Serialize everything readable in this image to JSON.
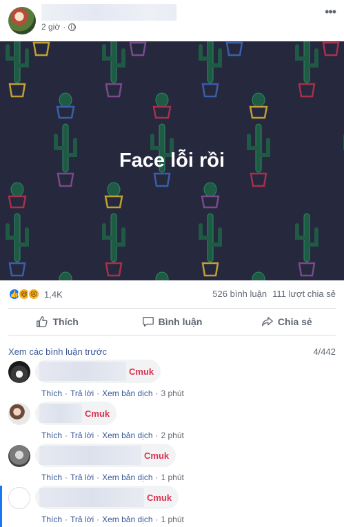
{
  "post": {
    "time": "2 giờ",
    "image_text": "Face lỗi rồi"
  },
  "stats": {
    "reaction_count": "1,4K",
    "comments": "526 bình luận",
    "shares": "111 lượt chia sẻ"
  },
  "actions": {
    "like": "Thích",
    "comment": "Bình luận",
    "share": "Chia sẻ"
  },
  "comments_section": {
    "view_previous": "Xem các bình luận trước",
    "count": "4/442",
    "items": [
      {
        "text": "Cmuk",
        "like": "Thích",
        "reply": "Trả lời",
        "translate": "Xem bản dịch",
        "time": "3 phút"
      },
      {
        "text": "Cmuk",
        "like": "Thích",
        "reply": "Trả lời",
        "translate": "Xem bản dịch",
        "time": "2 phút"
      },
      {
        "text": "Cmuk",
        "like": "Thích",
        "reply": "Trả lời",
        "translate": "Xem bản dịch",
        "time": "1 phút"
      },
      {
        "text": "Cmuk",
        "like": "Thích",
        "reply": "Trả lời",
        "translate": "Xem bản dịch",
        "time": "1 phút"
      }
    ]
  },
  "colors": {
    "image_bg": "#26283e",
    "link": "#385898",
    "comment_text": "#d9334f",
    "like_blue": "#1877f2"
  },
  "icons": [
    "globe-icon",
    "more-icon",
    "like-icon",
    "comment-icon",
    "share-icon",
    "cactus-pattern"
  ]
}
